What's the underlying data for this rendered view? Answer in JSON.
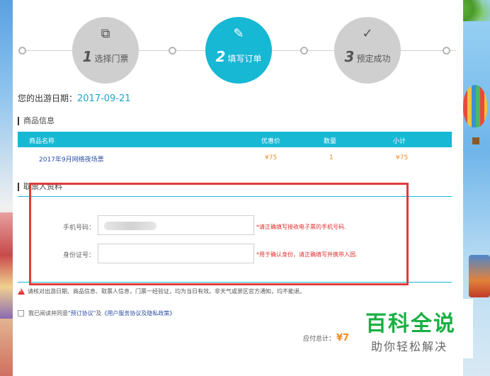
{
  "steps": [
    {
      "num": "1",
      "label": "选择门票",
      "icon": "ticket-icon",
      "active": false
    },
    {
      "num": "2",
      "label": "填写订单",
      "icon": "edit-icon",
      "active": true
    },
    {
      "num": "3",
      "label": "预定成功",
      "icon": "check-icon",
      "active": false
    }
  ],
  "trip_date": {
    "label": "您的出游日期：",
    "value": "2017-09-21"
  },
  "product_section": {
    "title": "商品信息",
    "columns": [
      "商品名称",
      "优惠价",
      "数量",
      "小计"
    ],
    "rows": [
      {
        "name": "2017年9月网络夜场票",
        "price": "¥75",
        "qty": "1",
        "subtotal": "¥75"
      }
    ]
  },
  "recipient_section": {
    "title": "取票人资料",
    "phone": {
      "label": "手机号码：",
      "value": "",
      "hint": "*请正确填写接收电子票的手机号码."
    },
    "id_card": {
      "label": "身份证号：",
      "value": "",
      "hint": "*用于确认身份，请正确填写并携带入园."
    }
  },
  "warning": "请核对出游日期、商品信息、取票人信息，门票一经验证，均为当日有效。非天气或景区官方通知，均不能退。",
  "agreement": {
    "prefix": "我已阅读并同意",
    "link1": "\"预订协议\"",
    "middle": "及",
    "link2": "《用户服务协议及隐私政策》"
  },
  "total": {
    "label": "应付总计：",
    "amount": "¥7"
  },
  "watermark": {
    "title": "百科全说",
    "subtitle": "助你轻松解决"
  },
  "colors": {
    "accent": "#16b8d4",
    "price": "#f28b20",
    "error": "#e03030",
    "highlight_box": "#e03a3a",
    "brand_green": "#19b043"
  }
}
